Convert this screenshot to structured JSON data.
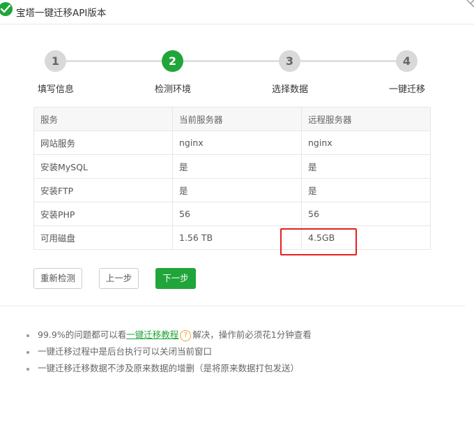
{
  "window": {
    "title": "宝塔一键迁移API版本"
  },
  "steps": [
    {
      "number": "1",
      "label": "填写信息",
      "state": "inactive"
    },
    {
      "number": "2",
      "label": "检测环境",
      "state": "active"
    },
    {
      "number": "3",
      "label": "选择数据",
      "state": "inactive"
    },
    {
      "number": "4",
      "label": "一键迁移",
      "state": "inactive"
    }
  ],
  "table": {
    "headers": [
      "服务",
      "当前服务器",
      "远程服务器"
    ],
    "rows": [
      [
        "网站服务",
        "nginx",
        "nginx"
      ],
      [
        "安装MySQL",
        "是",
        "是"
      ],
      [
        "安装FTP",
        "是",
        "是"
      ],
      [
        "安装PHP",
        "56",
        "56"
      ],
      [
        "可用磁盘",
        "1.56 TB",
        "4.5GB"
      ]
    ]
  },
  "buttons": {
    "recheck": "重新检测",
    "prev": "上一步",
    "next": "下一步"
  },
  "tips": {
    "tip1_prefix": "99.9%的问题都可以看",
    "tip1_link": "一键迁移教程",
    "tip1_help": "?",
    "tip1_suffix": "解决，操作前必须花1分钟查看",
    "tip2": "一键迁移过程中是后台执行可以关闭当前窗口",
    "tip3": "一键迁移迁移数据不涉及原来数据的增删（是将原来数据打包发送）"
  },
  "colors": {
    "accent": "#20a53a",
    "highlight": "#e61e1e",
    "help": "#f0a030"
  }
}
